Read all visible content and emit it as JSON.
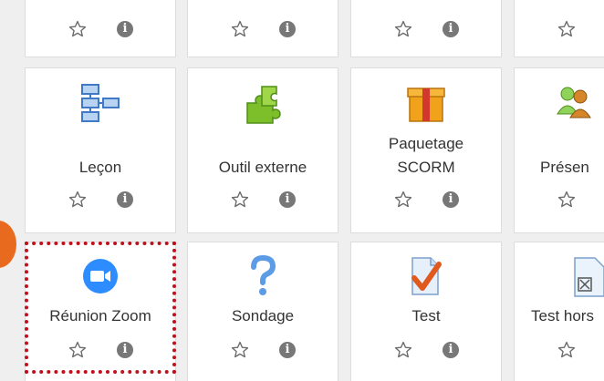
{
  "modules": [
    {
      "label": "",
      "icon": "module-icon"
    },
    {
      "label": "",
      "icon": "module-icon"
    },
    {
      "label": "",
      "icon": "module-icon"
    },
    {
      "label": "",
      "icon": "module-icon"
    },
    {
      "label": "Leçon",
      "icon": "lesson-flowchart-icon"
    },
    {
      "label": "Outil externe",
      "icon": "puzzle-piece-icon"
    },
    {
      "label": "Paquetage SCORM",
      "label_line1": "Paquetage",
      "label_line2": "SCORM",
      "icon": "scorm-package-icon"
    },
    {
      "label": "Présen",
      "icon": "attendance-people-icon"
    },
    {
      "label": "Réunion Zoom",
      "icon": "zoom-camera-icon"
    },
    {
      "label": "Sondage",
      "icon": "question-mark-icon"
    },
    {
      "label": "Test",
      "icon": "quiz-checkmark-icon"
    },
    {
      "label": "Test hors",
      "icon": "offline-quiz-icon"
    }
  ],
  "actions": {
    "star_icon": "star-outline-icon",
    "info_icon": "info-icon",
    "info_glyph": "i"
  },
  "colors": {
    "highlight": "#c0101b",
    "marker": "#e86a1f",
    "zoom": "#2d8cff",
    "star": "#6b6b6b"
  }
}
